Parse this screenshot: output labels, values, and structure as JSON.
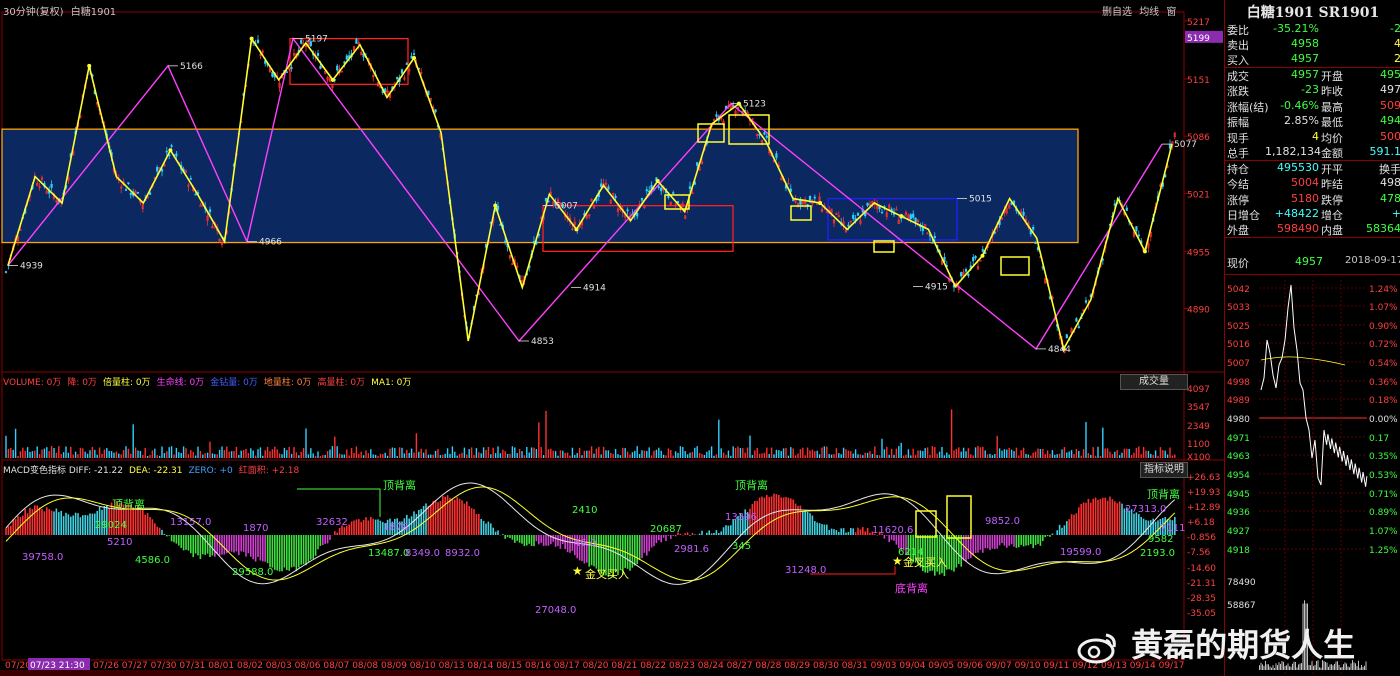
{
  "header": {
    "period": "30分钟(复权)",
    "symbol": "白糖1901",
    "tools": [
      "删自选",
      "均线",
      "窗"
    ]
  },
  "price_axis": {
    "ticks": [
      "5217",
      "5151",
      "5086",
      "5021",
      "4955",
      "4890"
    ],
    "current_tag": "5199"
  },
  "price_annotations": [
    {
      "text": "5166",
      "value": 5166
    },
    {
      "text": "5197",
      "value": 5197
    },
    {
      "text": "4966",
      "value": 4966
    },
    {
      "text": "4939",
      "value": 4939
    },
    {
      "text": "4853",
      "value": 4853
    },
    {
      "text": "5007",
      "value": 5007
    },
    {
      "text": "4914",
      "value": 4914
    },
    {
      "text": "5123",
      "value": 5123
    },
    {
      "text": "5015",
      "value": 5015
    },
    {
      "text": "4915",
      "value": 4915
    },
    {
      "text": "4844",
      "value": 4844
    },
    {
      "text": "5077",
      "value": 5077
    }
  ],
  "volume_panel": {
    "legend": [
      {
        "text": "VOLUME: 0万",
        "color": "#ff4040"
      },
      {
        "text": "降: 0万",
        "color": "#ff4040"
      },
      {
        "text": "倍量柱: 0万",
        "color": "#ffff40"
      },
      {
        "text": "生命线: 0万",
        "color": "#ff40ff"
      },
      {
        "text": "金钻量: 0万",
        "color": "#4060ff"
      },
      {
        "text": "地量柱: 0万",
        "color": "#ff8040"
      },
      {
        "text": "高量柱: 0万",
        "color": "#ff4040"
      },
      {
        "text": "MA1: 0万",
        "color": "#ffff40"
      }
    ],
    "button": "成交量",
    "ticks": [
      "4097",
      "3547",
      "2349",
      "1100",
      "X100"
    ]
  },
  "macd_panel": {
    "legend": [
      {
        "text": "MACD变色指标  DIFF: -21.22",
        "color": "#e0e0e0"
      },
      {
        "text": "DEA: -22.31",
        "color": "#ffff40"
      },
      {
        "text": "ZERO: +0",
        "color": "#40a0ff"
      },
      {
        "text": "红面积: +2.18",
        "color": "#ff4040"
      }
    ],
    "button": "指标说明",
    "ticks": [
      "+26.63",
      "+19.93",
      "+12.89",
      "+6.18",
      "-0.856",
      "-7.56",
      "-14.60",
      "-21.31",
      "-28.35",
      "-35.05"
    ],
    "annotations": [
      {
        "text": "顶背离",
        "color": "#40ff40"
      },
      {
        "text": "顶背离",
        "color": "#40ff40"
      },
      {
        "text": "顶背离",
        "color": "#40ff40"
      },
      {
        "text": "顶背离",
        "color": "#40ff40"
      },
      {
        "text": "底背离",
        "color": "#ff40ff"
      },
      {
        "text": "金叉买入",
        "color": "#ffff40"
      },
      {
        "text": "金叉买入",
        "color": "#ffff40"
      }
    ],
    "area_values": [
      "29024",
      "5210",
      "39758.0",
      "4586.0",
      "13157.0",
      "1870",
      "29588.0",
      "32632",
      "1878",
      "13487.0",
      "8349.0",
      "8932.0",
      "2410",
      "46.0",
      "27048.0",
      "20687",
      "2981.6",
      "13396",
      "345",
      "31248.0",
      "11620.6",
      "6214",
      "9852.0",
      "19599.0",
      "2193.0",
      "27313.0",
      "7111",
      "9582",
      "4917.0"
    ]
  },
  "x_axis": {
    "dates": [
      "07/20",
      "07/23 21:30",
      "07/26",
      "07/27",
      "07/30",
      "07/31",
      "08/01",
      "08/02",
      "08/03",
      "08/06",
      "08/07",
      "08/08",
      "08/09",
      "08/10",
      "08/13",
      "08/14",
      "08/15",
      "08/16",
      "08/17",
      "08/20",
      "08/21",
      "08/22",
      "08/23",
      "08/24",
      "08/27",
      "08/28",
      "08/29",
      "08/30",
      "08/31",
      "09/03",
      "09/04",
      "09/05",
      "09/06",
      "09/07",
      "09/10",
      "09/11",
      "09/12",
      "09/13",
      "09/14",
      "09/17"
    ]
  },
  "quote": {
    "title": "白糖1901 SR1901",
    "rows": [
      {
        "l": "委比",
        "v1": "-35.21%",
        "c1": "#40ff40",
        "l2": "",
        "v2": "-2",
        "c2": "#40ff40"
      },
      {
        "l": "卖出",
        "v1": "4958",
        "c1": "#40ff40",
        "l2": "",
        "v2": "4",
        "c2": "#ffff40"
      },
      {
        "l": "买入",
        "v1": "4957",
        "c1": "#40ff40",
        "l2": "",
        "v2": "2",
        "c2": "#ffff40"
      },
      {
        "l": "成交",
        "v1": "4957",
        "c1": "#40ff40",
        "l2": "开盘",
        "v2": "495",
        "c2": "#40ff40"
      },
      {
        "l": "涨跌",
        "v1": "-23",
        "c1": "#40ff40",
        "l2": "昨收",
        "v2": "497",
        "c2": "#e0e0e0"
      },
      {
        "l": "涨幅(结)",
        "v1": "-0.46%",
        "c1": "#40ff40",
        "l2": "最高",
        "v2": "509",
        "c2": "#ff4040"
      },
      {
        "l": "振幅",
        "v1": "2.85%",
        "c1": "#e0e0e0",
        "l2": "最低",
        "v2": "494",
        "c2": "#40ff40"
      },
      {
        "l": "现手",
        "v1": "4",
        "c1": "#ffff40",
        "l2": "均价",
        "v2": "500",
        "c2": "#ff4040"
      },
      {
        "l": "总手",
        "v1": "1,182,134",
        "c1": "#e0e0e0",
        "l2": "金额",
        "v2": "591.1",
        "c2": "#40ffff"
      },
      {
        "l": "持仓",
        "v1": "495530",
        "c1": "#40ffff",
        "l2": "开平",
        "v2": "换手",
        "c2": "#e0e0e0"
      },
      {
        "l": "今结",
        "v1": "5004",
        "c1": "#ff4040",
        "l2": "昨结",
        "v2": "498",
        "c2": "#e0e0e0"
      },
      {
        "l": "涨停",
        "v1": "5180",
        "c1": "#ff4040",
        "l2": "跌停",
        "v2": "478",
        "c2": "#40ff40"
      },
      {
        "l": "日增仓",
        "v1": "+48422",
        "c1": "#40ffff",
        "l2": "增仓",
        "v2": "+",
        "c2": "#40ffff"
      },
      {
        "l": "外盘",
        "v1": "598490",
        "c1": "#ff4040",
        "l2": "内盘",
        "v2": "58364",
        "c2": "#40ff40"
      }
    ],
    "current_label": "现价",
    "current_value": "4957",
    "current_date": "2018-09-17,-"
  },
  "minichart": {
    "left_ticks": [
      "5042",
      "5033",
      "5025",
      "5016",
      "5007",
      "4998",
      "4989",
      "4980",
      "4971",
      "4963",
      "4954",
      "4945",
      "4936",
      "4927",
      "4918",
      "78490",
      "58867"
    ],
    "right_ticks": [
      "1.24%",
      "1.07%",
      "0.90%",
      "0.72%",
      "0.54%",
      "0.36%",
      "0.18%",
      "0.00%",
      "0.17",
      "0.35%",
      "0.53%",
      "0.71%",
      "0.89%",
      "1.07%",
      "1.25%"
    ]
  },
  "watermark": "黄磊的期货人生",
  "chart_data": {
    "type": "candlestick",
    "instrument": "白糖1901",
    "interval": "30分钟",
    "ylim": [
      4820,
      5225
    ],
    "zigzag_magenta": [
      4939,
      5166,
      4966,
      5197,
      4853,
      5123,
      4844,
      5077
    ],
    "zigzag_yellow": [
      4939,
      5040,
      5010,
      5166,
      5040,
      5010,
      5070,
      5020,
      4966,
      5197,
      5150,
      5192,
      5150,
      5190,
      5130,
      5175,
      5090,
      4853,
      5007,
      4914,
      5020,
      4980,
      5030,
      4990,
      5035,
      5000,
      5100,
      5123,
      5080,
      5015,
      5010,
      4980,
      5010,
      4995,
      4980,
      4915,
      4950,
      5015,
      4970,
      4844,
      4900,
      5015,
      4955,
      5077
    ],
    "zones": [
      {
        "color": "#ffa500",
        "top": 5094,
        "bottom": 4965
      },
      {
        "color": "#ff2020",
        "top": 5197,
        "bottom": 5145
      },
      {
        "color": "#ff2020",
        "top": 5007,
        "bottom": 4955
      },
      {
        "color": "#2020ff",
        "top": 5015,
        "bottom": 4968
      }
    ]
  }
}
